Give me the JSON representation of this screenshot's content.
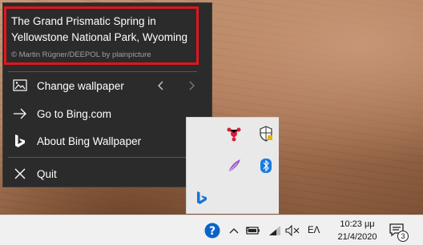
{
  "wallpaper_menu": {
    "caption": {
      "title": "The Grand Prismatic Spring in Yellowstone National Park, Wyoming",
      "credit": "© Martin Rügner/DEEPOL by plainpicture"
    },
    "items": [
      {
        "label": "Change wallpaper",
        "icon": "image-icon"
      },
      {
        "label": "Go to Bing.com",
        "icon": "arrow-right-icon"
      },
      {
        "label": "About Bing Wallpaper",
        "icon": "bing-logo-icon"
      },
      {
        "label": "Quit",
        "icon": "close-icon"
      }
    ],
    "highlight_color": "#e0161e"
  },
  "tray_popup": {
    "icons": [
      "red-app-icon",
      "security-shield-icon",
      "feather-icon",
      "bluetooth-icon",
      "bing-wallpaper-icon"
    ]
  },
  "taskbar": {
    "language": "ΕΛ",
    "time": "10:23 μμ",
    "date": "21/4/2020",
    "notification_count": "3",
    "icons": [
      "help-icon",
      "chevron-up-icon",
      "battery-icon",
      "wifi-icon",
      "volume-muted-icon",
      "notification-icon"
    ]
  }
}
